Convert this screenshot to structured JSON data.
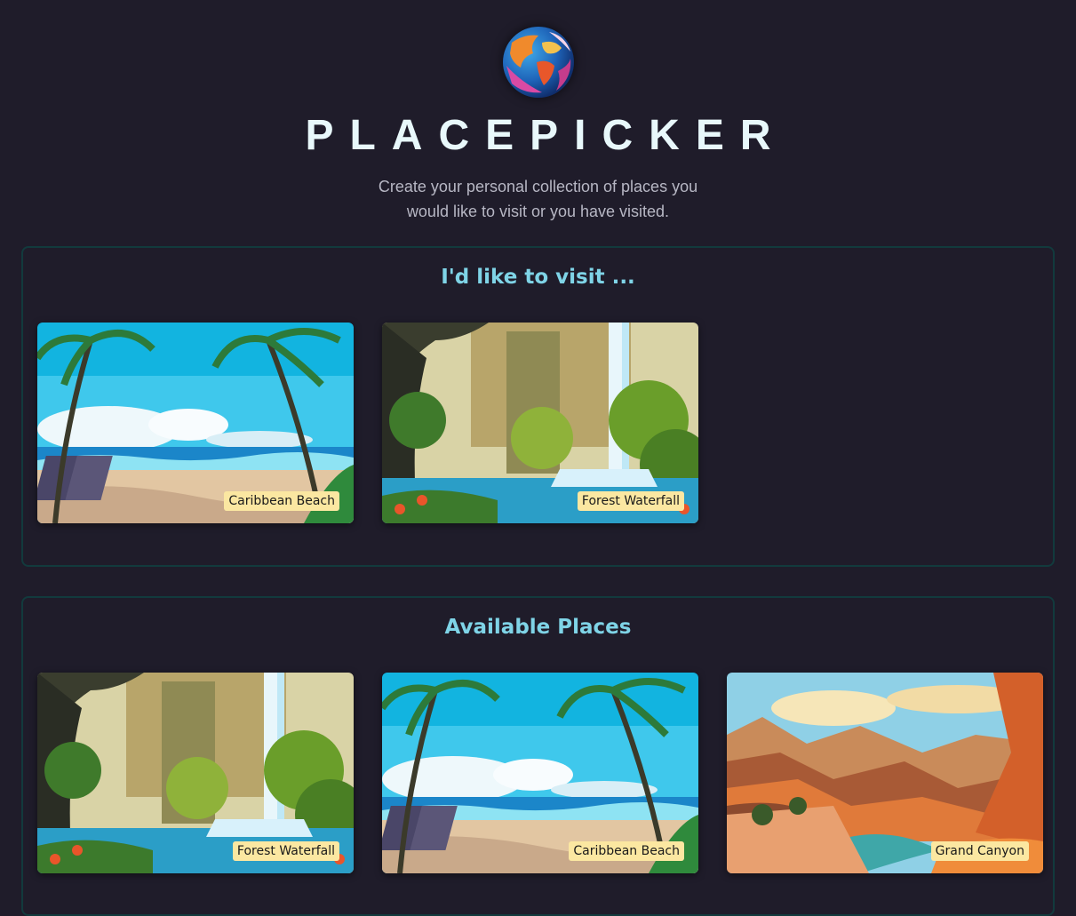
{
  "header": {
    "title": "PLACEPICKER",
    "subtitle": "Create your personal collection of places you would like to visit or you have visited."
  },
  "visit_section": {
    "title": "I'd like to visit ...",
    "places": [
      {
        "label": "Caribbean Beach",
        "scene": "beach"
      },
      {
        "label": "Forest Waterfall",
        "scene": "waterfall"
      }
    ]
  },
  "available_section": {
    "title": "Available Places",
    "places": [
      {
        "label": "Forest Waterfall",
        "scene": "waterfall"
      },
      {
        "label": "Caribbean Beach",
        "scene": "beach"
      },
      {
        "label": "Grand Canyon",
        "scene": "canyon"
      }
    ]
  }
}
